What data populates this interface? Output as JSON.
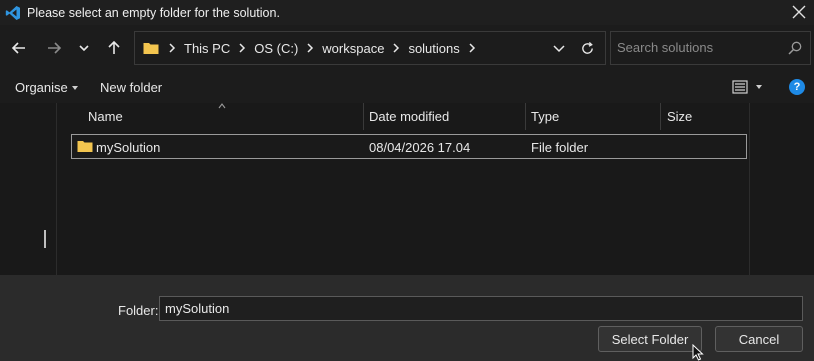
{
  "window": {
    "title": "Please select an empty folder for the solution."
  },
  "address_bar": {
    "crumbs": [
      "This PC",
      "OS (C:)",
      "workspace",
      "solutions"
    ]
  },
  "search": {
    "placeholder": "Search solutions"
  },
  "toolbar": {
    "organise_label": "Organise",
    "new_folder_label": "New folder",
    "help_label": "?"
  },
  "columns": {
    "name": "Name",
    "date_modified": "Date modified",
    "type": "Type",
    "size": "Size"
  },
  "rows": [
    {
      "name": "mySolution",
      "date_modified": "08/04/2026 17.04",
      "type": "File folder",
      "size": ""
    }
  ],
  "footer": {
    "folder_label": "Folder:",
    "folder_value": "mySolution",
    "select_button": "Select Folder",
    "cancel_button": "Cancel"
  },
  "colors": {
    "accent": "#1e8ae6",
    "folder": "#f3c54f",
    "app_icon": "#2f95e0"
  },
  "icons": [
    "vscode-icon",
    "close-icon",
    "back-arrow-icon",
    "forward-arrow-icon",
    "recent-chevron-icon",
    "up-arrow-icon",
    "folder-icon",
    "chevron-right-icon",
    "dropdown-chevron-icon",
    "refresh-icon",
    "search-icon",
    "view-options-icon",
    "help-icon",
    "sort-caret-icon",
    "mouse-cursor-icon"
  ]
}
